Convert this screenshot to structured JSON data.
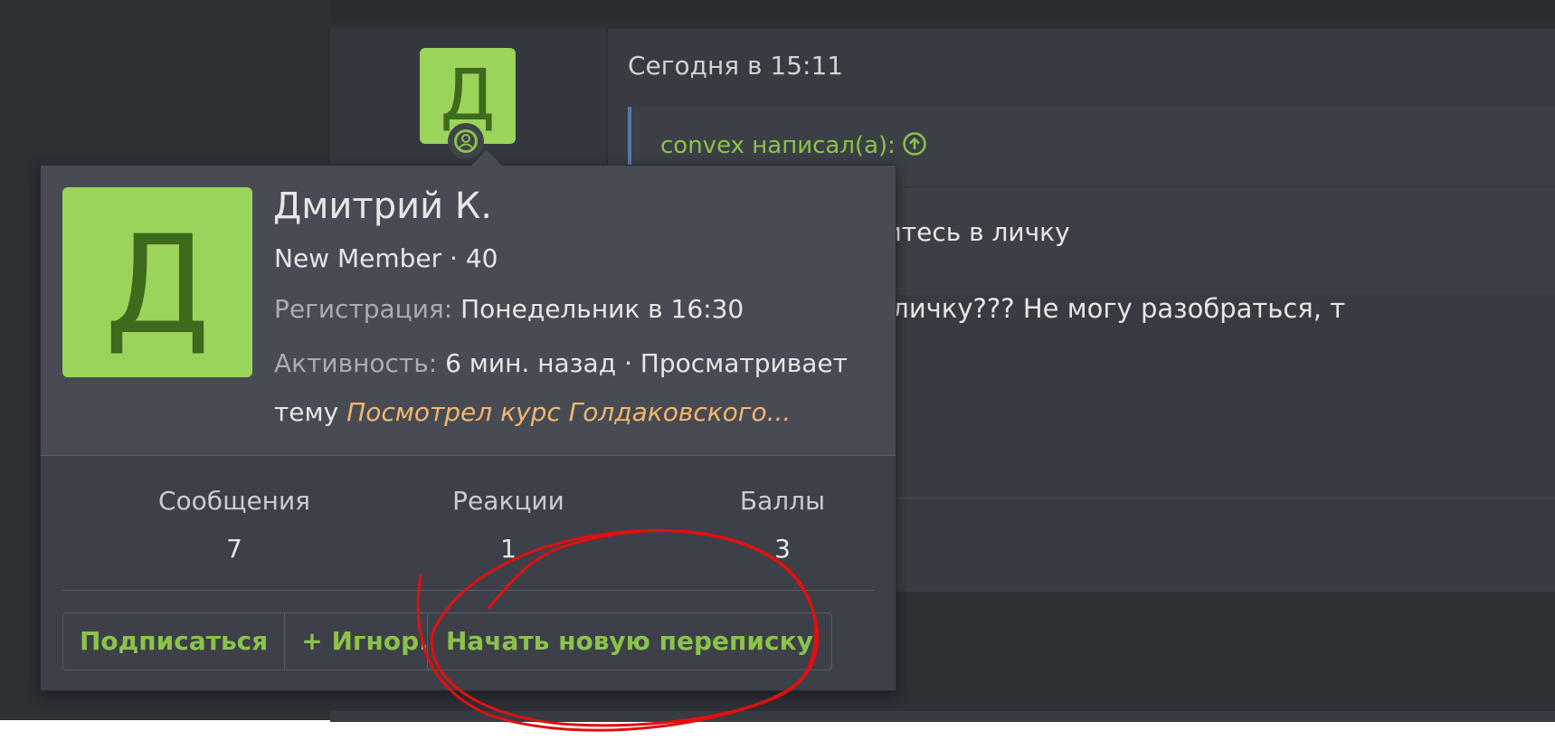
{
  "post": {
    "avatar_letter": "Д",
    "date": "Сегодня в 15:11",
    "quote_author": "convex написал(а):",
    "quote_text": "интересно - стучитесь в личку",
    "reply_text": "А как тут писать в личку??? Не могу разобраться, т"
  },
  "tooltip": {
    "avatar_letter": "Д",
    "name": "Дмитрий К.",
    "user_title": "New Member · 40",
    "registration_label": "Регистрация:",
    "registration_value": "Понедельник в 16:30",
    "activity_label": "Активность:",
    "activity_value": "6 мин. назад · Просматривает",
    "activity_prefix": "тему",
    "activity_thread": "Посмотрел курс Голдаковского...",
    "stats": [
      {
        "label": "Сообщения",
        "value": "7"
      },
      {
        "label": "Реакции",
        "value": "1"
      },
      {
        "label": "Баллы",
        "value": "3"
      }
    ],
    "buttons": {
      "follow": "Подписаться",
      "ignore": "+ Игнор.",
      "start_conversation": "Начать новую переписку"
    }
  },
  "colors": {
    "accent_green": "#8bc34a",
    "avatar_bg": "#9ad45a",
    "thread_link": "#f2b66f",
    "annotation_red": "#e01010"
  },
  "icons": [
    "online-status-icon",
    "quote-jump-arrow-icon"
  ]
}
